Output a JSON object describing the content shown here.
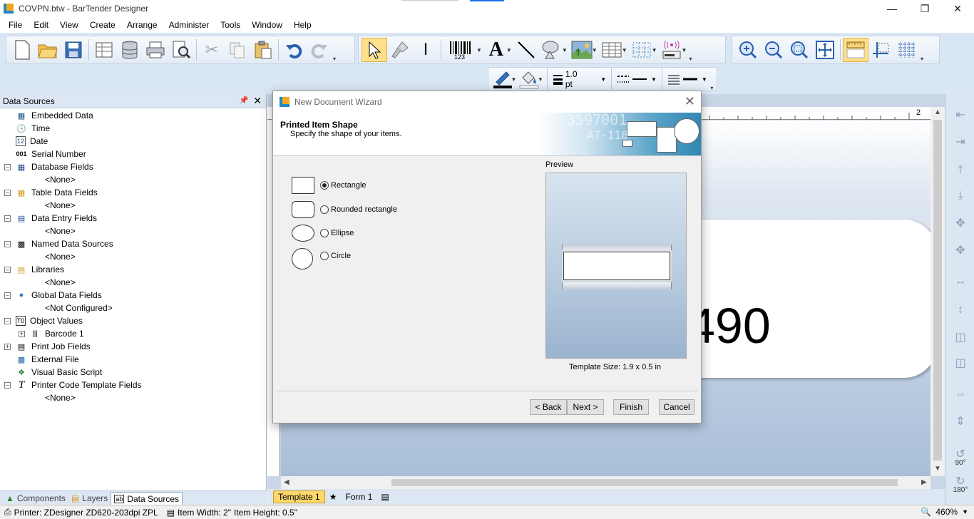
{
  "window": {
    "title": "COVPN.btw - BarTender Designer"
  },
  "menu": [
    "File",
    "Edit",
    "View",
    "Create",
    "Arrange",
    "Administer",
    "Tools",
    "Window",
    "Help"
  ],
  "toolbar": {
    "line_width": "1.0 pt"
  },
  "data_sources": {
    "header": "Data Sources",
    "items": [
      {
        "label": "Embedded Data",
        "icon": "embedded-data-icon"
      },
      {
        "label": "Time",
        "icon": "clock-icon"
      },
      {
        "label": "Date",
        "icon": "calendar-icon"
      },
      {
        "label": "Serial Number",
        "icon": "serial-number-icon"
      },
      {
        "label": "Database Fields",
        "icon": "database-fields-icon"
      },
      {
        "label": "<None>"
      },
      {
        "label": "Table Data Fields",
        "icon": "table-icon"
      },
      {
        "label": "<None>"
      },
      {
        "label": "Data Entry Fields",
        "icon": "form-icon"
      },
      {
        "label": "<None>"
      },
      {
        "label": "Named Data Sources",
        "icon": "named-sources-icon"
      },
      {
        "label": "<None>"
      },
      {
        "label": "Libraries",
        "icon": "library-icon"
      },
      {
        "label": "<None>"
      },
      {
        "label": "Global Data Fields",
        "icon": "globe-icon"
      },
      {
        "label": "<Not Configured>"
      },
      {
        "label": "Object Values",
        "icon": "object-values-icon"
      },
      {
        "label": "Barcode 1",
        "icon": "barcode-icon"
      },
      {
        "label": "Print Job Fields",
        "icon": "print-job-icon"
      },
      {
        "label": "External File",
        "icon": "file-icon"
      },
      {
        "label": "Visual Basic Script",
        "icon": "script-icon"
      },
      {
        "label": "Printer Code Template Fields",
        "icon": "printer-code-icon"
      },
      {
        "label": "<None>"
      }
    ],
    "tabs": [
      "Components",
      "Layers",
      "Data Sources"
    ]
  },
  "ruler": {
    "mark": "2",
    "unit": "in"
  },
  "canvas": {
    "label_text": "490"
  },
  "doc_tabs": [
    "Template 1",
    "Form 1"
  ],
  "align": {
    "rotate_90": "90°",
    "rotate_180": "180°"
  },
  "status": {
    "printer": "Printer: ZDesigner ZD620-203dpi ZPL",
    "item_width": "Item Width: 2\"",
    "item_height": "Item Height: 0.5\"",
    "zoom": "460%"
  },
  "dialog": {
    "title": "New Document Wizard",
    "heading": "Printed Item Shape",
    "subheading": "Specify the shape of your items.",
    "banner_num1": "3597001",
    "banner_num2": "A7-118",
    "shapes": [
      {
        "label": "Rectangle",
        "selected": true
      },
      {
        "label": "Rounded rectangle",
        "selected": false
      },
      {
        "label": "Ellipse",
        "selected": false
      },
      {
        "label": "Circle",
        "selected": false
      }
    ],
    "preview_label": "Preview",
    "template_size": "Template Size:  1.9 x 0.5 in",
    "buttons": {
      "back": "< Back",
      "next": "Next >",
      "finish": "Finish",
      "cancel": "Cancel"
    }
  }
}
